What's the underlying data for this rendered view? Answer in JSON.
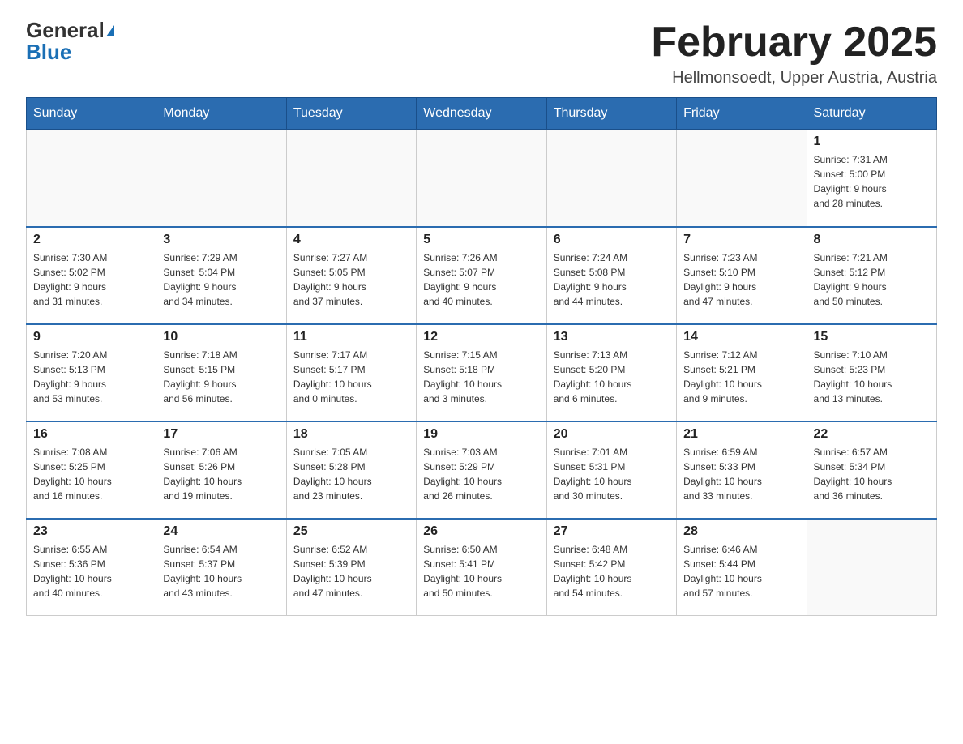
{
  "header": {
    "logo_general": "General",
    "logo_blue": "Blue",
    "month_title": "February 2025",
    "location": "Hellmonsoedt, Upper Austria, Austria"
  },
  "weekdays": [
    "Sunday",
    "Monday",
    "Tuesday",
    "Wednesday",
    "Thursday",
    "Friday",
    "Saturday"
  ],
  "weeks": [
    [
      {
        "day": "",
        "info": ""
      },
      {
        "day": "",
        "info": ""
      },
      {
        "day": "",
        "info": ""
      },
      {
        "day": "",
        "info": ""
      },
      {
        "day": "",
        "info": ""
      },
      {
        "day": "",
        "info": ""
      },
      {
        "day": "1",
        "info": "Sunrise: 7:31 AM\nSunset: 5:00 PM\nDaylight: 9 hours\nand 28 minutes."
      }
    ],
    [
      {
        "day": "2",
        "info": "Sunrise: 7:30 AM\nSunset: 5:02 PM\nDaylight: 9 hours\nand 31 minutes."
      },
      {
        "day": "3",
        "info": "Sunrise: 7:29 AM\nSunset: 5:04 PM\nDaylight: 9 hours\nand 34 minutes."
      },
      {
        "day": "4",
        "info": "Sunrise: 7:27 AM\nSunset: 5:05 PM\nDaylight: 9 hours\nand 37 minutes."
      },
      {
        "day": "5",
        "info": "Sunrise: 7:26 AM\nSunset: 5:07 PM\nDaylight: 9 hours\nand 40 minutes."
      },
      {
        "day": "6",
        "info": "Sunrise: 7:24 AM\nSunset: 5:08 PM\nDaylight: 9 hours\nand 44 minutes."
      },
      {
        "day": "7",
        "info": "Sunrise: 7:23 AM\nSunset: 5:10 PM\nDaylight: 9 hours\nand 47 minutes."
      },
      {
        "day": "8",
        "info": "Sunrise: 7:21 AM\nSunset: 5:12 PM\nDaylight: 9 hours\nand 50 minutes."
      }
    ],
    [
      {
        "day": "9",
        "info": "Sunrise: 7:20 AM\nSunset: 5:13 PM\nDaylight: 9 hours\nand 53 minutes."
      },
      {
        "day": "10",
        "info": "Sunrise: 7:18 AM\nSunset: 5:15 PM\nDaylight: 9 hours\nand 56 minutes."
      },
      {
        "day": "11",
        "info": "Sunrise: 7:17 AM\nSunset: 5:17 PM\nDaylight: 10 hours\nand 0 minutes."
      },
      {
        "day": "12",
        "info": "Sunrise: 7:15 AM\nSunset: 5:18 PM\nDaylight: 10 hours\nand 3 minutes."
      },
      {
        "day": "13",
        "info": "Sunrise: 7:13 AM\nSunset: 5:20 PM\nDaylight: 10 hours\nand 6 minutes."
      },
      {
        "day": "14",
        "info": "Sunrise: 7:12 AM\nSunset: 5:21 PM\nDaylight: 10 hours\nand 9 minutes."
      },
      {
        "day": "15",
        "info": "Sunrise: 7:10 AM\nSunset: 5:23 PM\nDaylight: 10 hours\nand 13 minutes."
      }
    ],
    [
      {
        "day": "16",
        "info": "Sunrise: 7:08 AM\nSunset: 5:25 PM\nDaylight: 10 hours\nand 16 minutes."
      },
      {
        "day": "17",
        "info": "Sunrise: 7:06 AM\nSunset: 5:26 PM\nDaylight: 10 hours\nand 19 minutes."
      },
      {
        "day": "18",
        "info": "Sunrise: 7:05 AM\nSunset: 5:28 PM\nDaylight: 10 hours\nand 23 minutes."
      },
      {
        "day": "19",
        "info": "Sunrise: 7:03 AM\nSunset: 5:29 PM\nDaylight: 10 hours\nand 26 minutes."
      },
      {
        "day": "20",
        "info": "Sunrise: 7:01 AM\nSunset: 5:31 PM\nDaylight: 10 hours\nand 30 minutes."
      },
      {
        "day": "21",
        "info": "Sunrise: 6:59 AM\nSunset: 5:33 PM\nDaylight: 10 hours\nand 33 minutes."
      },
      {
        "day": "22",
        "info": "Sunrise: 6:57 AM\nSunset: 5:34 PM\nDaylight: 10 hours\nand 36 minutes."
      }
    ],
    [
      {
        "day": "23",
        "info": "Sunrise: 6:55 AM\nSunset: 5:36 PM\nDaylight: 10 hours\nand 40 minutes."
      },
      {
        "day": "24",
        "info": "Sunrise: 6:54 AM\nSunset: 5:37 PM\nDaylight: 10 hours\nand 43 minutes."
      },
      {
        "day": "25",
        "info": "Sunrise: 6:52 AM\nSunset: 5:39 PM\nDaylight: 10 hours\nand 47 minutes."
      },
      {
        "day": "26",
        "info": "Sunrise: 6:50 AM\nSunset: 5:41 PM\nDaylight: 10 hours\nand 50 minutes."
      },
      {
        "day": "27",
        "info": "Sunrise: 6:48 AM\nSunset: 5:42 PM\nDaylight: 10 hours\nand 54 minutes."
      },
      {
        "day": "28",
        "info": "Sunrise: 6:46 AM\nSunset: 5:44 PM\nDaylight: 10 hours\nand 57 minutes."
      },
      {
        "day": "",
        "info": ""
      }
    ]
  ]
}
